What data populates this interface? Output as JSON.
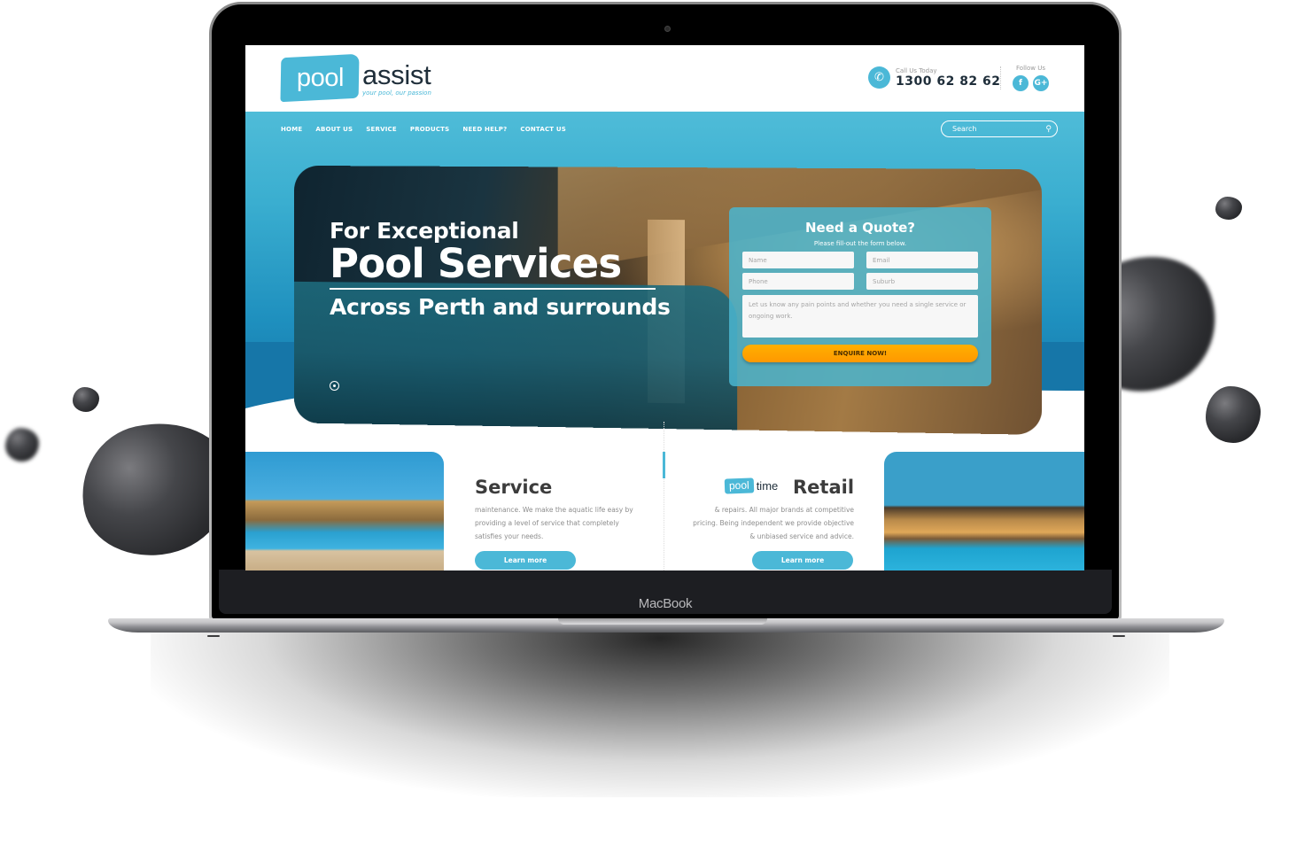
{
  "device": {
    "brand_label": "MacBook"
  },
  "header": {
    "logo": {
      "badge_text": "pool",
      "word": "assist",
      "tagline": "your pool, our passion"
    },
    "call": {
      "icon": "phone-icon",
      "label": "Call Us Today",
      "number": "1300 62 82 62"
    },
    "follow": {
      "label": "Follow Us",
      "facebook_glyph": "f",
      "google_glyph": "G+"
    }
  },
  "nav": {
    "items": [
      {
        "label": "HOME"
      },
      {
        "label": "ABOUT US"
      },
      {
        "label": "SERVICE"
      },
      {
        "label": "PRODUCTS"
      },
      {
        "label": "NEED HELP?"
      },
      {
        "label": "CONTACT US"
      }
    ],
    "search": {
      "placeholder": "Search",
      "value": "",
      "icon_glyph": "⚲"
    }
  },
  "hero": {
    "line1": "For Exceptional",
    "line2": "Pool Services",
    "line3": "Across Perth and surrounds",
    "slides_total": 1,
    "active_slide": 1
  },
  "quote_form": {
    "title": "Need a Quote?",
    "subtitle": "Please fill-out the form below.",
    "fields": {
      "name_placeholder": "Name",
      "email_placeholder": "Email",
      "phone_placeholder": "Phone",
      "suburb_placeholder": "Suburb",
      "message_placeholder": "Let us know any pain points and whether you need a single service or ongoing work."
    },
    "submit_label": "ENQUIRE NOW!"
  },
  "services": [
    {
      "title": "Service",
      "body": "maintenance. We make the aquatic life easy by providing a level of service that completely satisfies your needs.",
      "button_label": "Learn more"
    },
    {
      "logo_badge": "pool",
      "logo_word": "time",
      "title": "Retail",
      "body": "& repairs. All major brands at competitive pricing. Being independent we provide objective & unbiased service and advice.",
      "button_label": "Learn more"
    }
  ],
  "colors": {
    "brand": "#4bb8d7",
    "dark_text": "#1f2e3a",
    "cta": "#ffa500"
  }
}
